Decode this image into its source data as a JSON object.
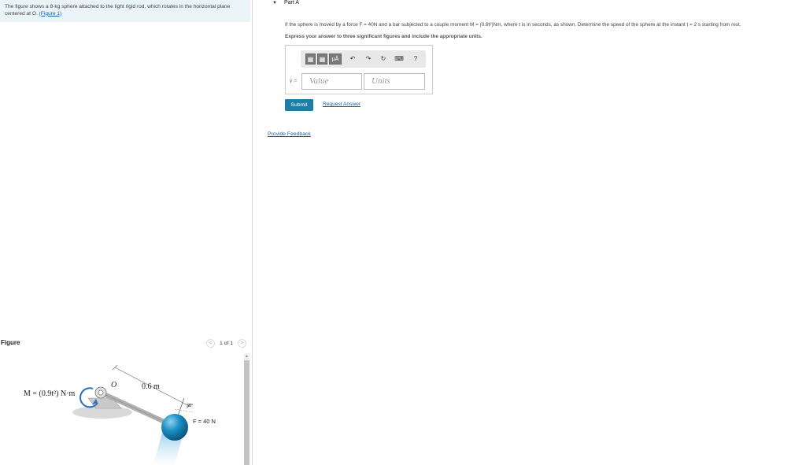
{
  "intro": {
    "line1": "The figure shows a 8-kg sphere attached to the light rigid rod, which rotates in the horizontal plane",
    "line2": "centered at O.",
    "figure_link": "(Figure 1)"
  },
  "figure_panel": {
    "title": "Figure",
    "pager_prev": "<",
    "pager_count": "1 of 1",
    "pager_next": ">",
    "labels": {
      "moment": "M = (0.9t²) N·m",
      "origin": "O",
      "length": "0.6 m",
      "angle": "35°",
      "force": "F = 40 N"
    },
    "colors": {
      "rod": "#b8b8b8",
      "sphere": "#1a8fc4",
      "base": "#c9c9c9",
      "arrow": "#2b6fb8"
    }
  },
  "part": {
    "caret": "▼",
    "title": "Part A",
    "question": "If the sphere is moved by a force F = 40N and a bar subjected to a couple moment M = (0.9t²)Nm, where t is in seconds, as shown. Determine the speed of the sphere at the instant t = 2 s starting from rest.",
    "express": "Express your answer to three significant figures and include the appropriate units.",
    "toolbar": {
      "template": "▦",
      "mu": "μÅ",
      "undo": "↶",
      "redo": "↷",
      "reset": "↻",
      "keyboard": "⌨",
      "help": "?"
    },
    "answer_label": "v =",
    "value_placeholder": "Value",
    "units_placeholder": "Units",
    "submit": "Submit",
    "request_answer": "Request Answer"
  },
  "feedback": "Provide Feedback"
}
